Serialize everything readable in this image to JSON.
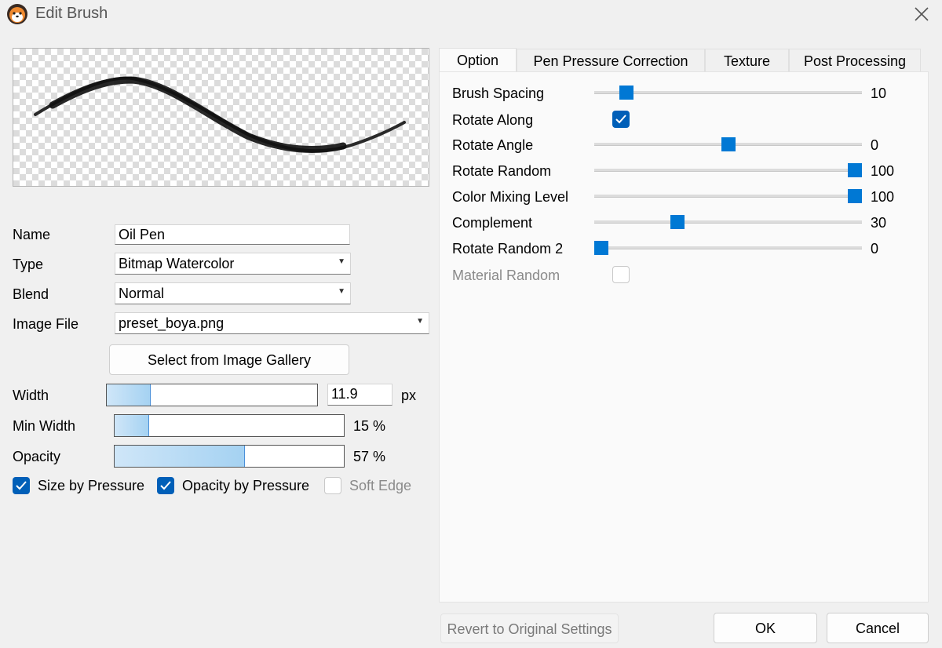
{
  "window": {
    "title": "Edit Brush",
    "app_icon": "fox-avatar-icon",
    "close_icon": "close-icon"
  },
  "form": {
    "name_label": "Name",
    "name_value": "Oil Pen",
    "type_label": "Type",
    "type_value": "Bitmap Watercolor",
    "blend_label": "Blend",
    "blend_value": "Normal",
    "image_file_label": "Image File",
    "image_file_value": "preset_boya.png",
    "gallery_button": "Select from Image Gallery",
    "width_label": "Width",
    "width_value": "11.9",
    "width_unit": "px",
    "width_fill_fraction": 0.21,
    "min_width_label": "Min Width",
    "min_width_value": "15 %",
    "min_width_fill_fraction": 0.15,
    "opacity_label": "Opacity",
    "opacity_value": "57 %",
    "opacity_fill_fraction": 0.57
  },
  "checkboxes": {
    "size_by_pressure": {
      "label": "Size by Pressure",
      "checked": true
    },
    "opacity_by_pressure": {
      "label": "Opacity by Pressure",
      "checked": true
    },
    "soft_edge": {
      "label": "Soft Edge",
      "checked": false,
      "disabled": true
    }
  },
  "tabs": [
    {
      "label": "Option",
      "active": true
    },
    {
      "label": "Pen Pressure Correction",
      "active": false
    },
    {
      "label": "Texture",
      "active": false
    },
    {
      "label": "Post Processing",
      "active": false
    }
  ],
  "options": {
    "brush_spacing": {
      "label": "Brush Spacing",
      "value": "10",
      "slider_fraction": 0.1
    },
    "rotate_along": {
      "label": "Rotate Along",
      "checked": true
    },
    "rotate_angle": {
      "label": "Rotate Angle",
      "value": "0",
      "slider_fraction": 0.5
    },
    "rotate_random": {
      "label": "Rotate Random",
      "value": "100",
      "slider_fraction": 1.0
    },
    "color_mixing_level": {
      "label": "Color Mixing Level",
      "value": "100",
      "slider_fraction": 1.0
    },
    "complement": {
      "label": "Complement",
      "value": "30",
      "slider_fraction": 0.3
    },
    "rotate_random_2": {
      "label": "Rotate Random 2",
      "value": "0",
      "slider_fraction": 0.0
    },
    "material_random": {
      "label": "Material Random",
      "checked": false,
      "disabled": true
    }
  },
  "footer": {
    "revert_button": "Revert to Original Settings",
    "ok_button": "OK",
    "cancel_button": "Cancel"
  },
  "colors": {
    "accent": "#0078d4",
    "checkbox": "#005fb8",
    "bar_fill": "#a5d2f2"
  }
}
